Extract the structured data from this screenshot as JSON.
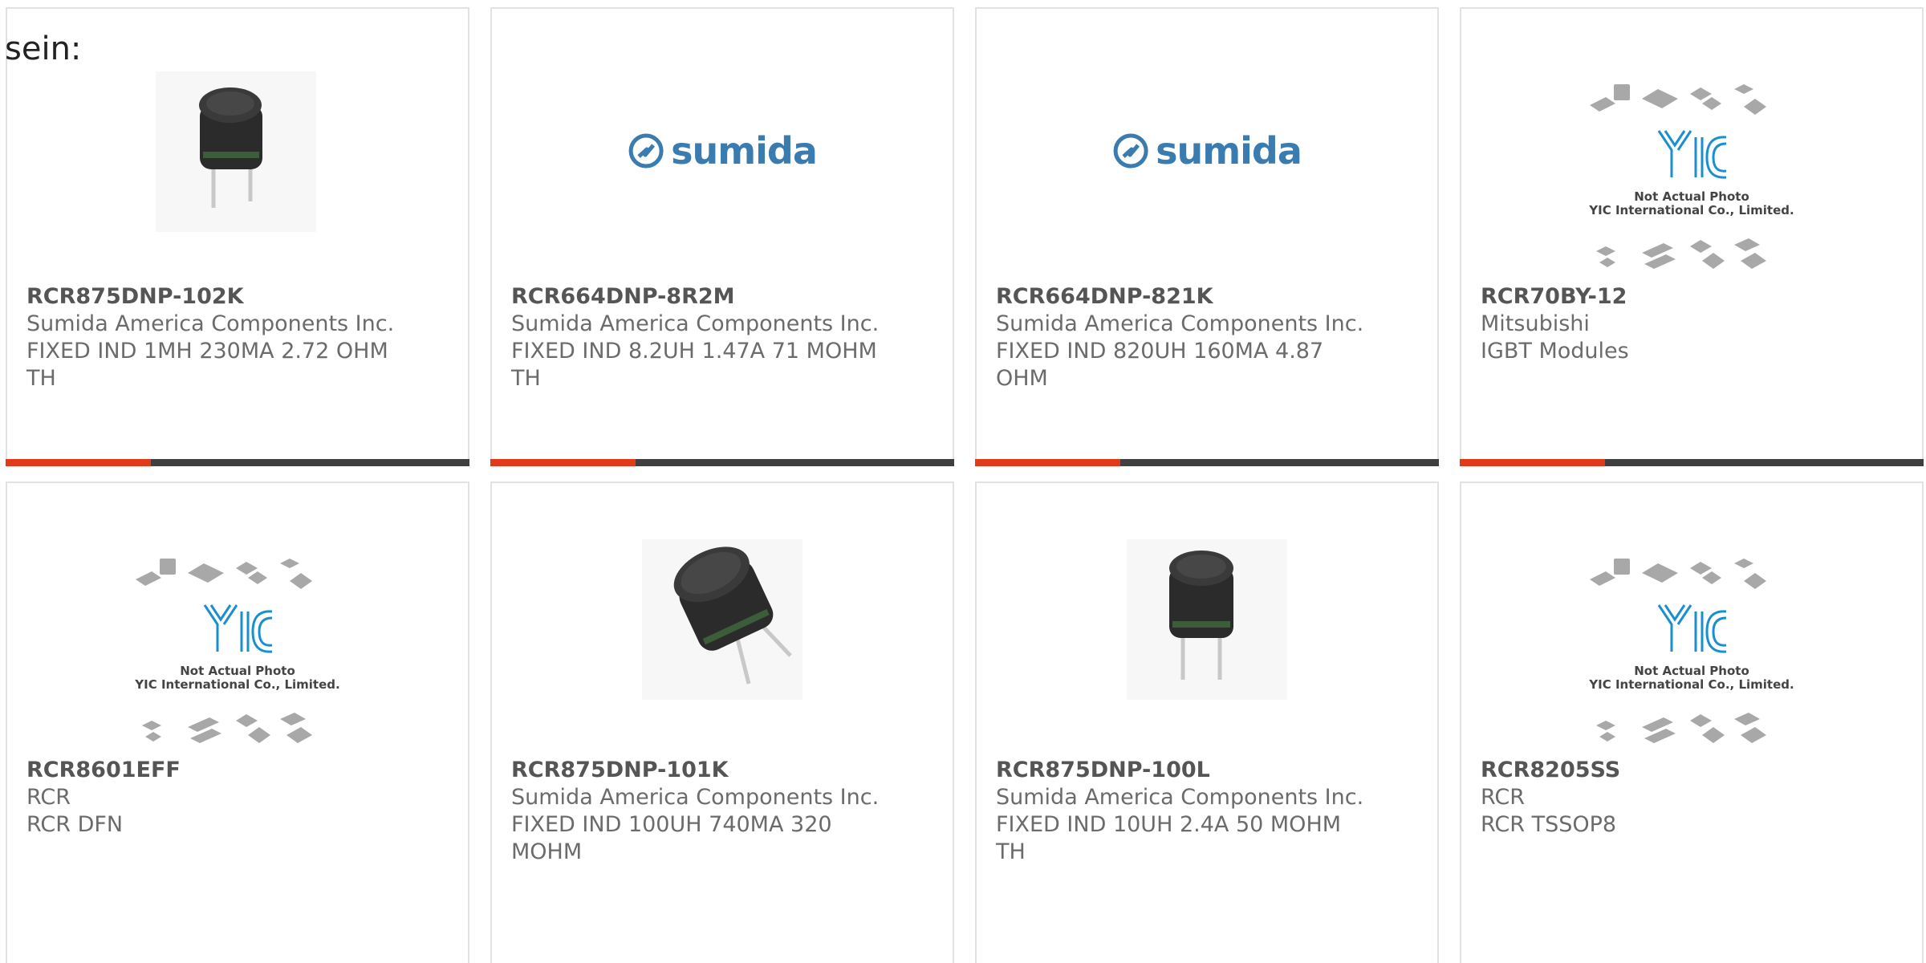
{
  "intro_text": "sein:",
  "colors": {
    "accent": "#e2391a",
    "bar": "#3f3f3f",
    "sumida_blue": "#3a7bb0",
    "yic_blue": "#1a8fd0"
  },
  "placeholder_caption": {
    "line1": "Not Actual Photo",
    "line2": "YIC International Co., Limited."
  },
  "sumida_logo": "sumida",
  "yic_logo": "YIC",
  "products": [
    {
      "part": "RCR875DNP-102K",
      "maker": "Sumida America Components Inc.",
      "desc": "FIXED IND 1MH 230MA 2.72 OHM TH",
      "image": "inductor-photo"
    },
    {
      "part": "RCR664DNP-8R2M",
      "maker": "Sumida America Components Inc.",
      "desc": "FIXED IND 8.2UH 1.47A 71 MOHM TH",
      "image": "sumida-logo"
    },
    {
      "part": "RCR664DNP-821K",
      "maker": "Sumida America Components Inc.",
      "desc": "FIXED IND 820UH 160MA 4.87 OHM",
      "image": "sumida-logo"
    },
    {
      "part": "RCR70BY-12",
      "maker": "Mitsubishi",
      "desc": "IGBT Modules",
      "image": "yic-placeholder"
    },
    {
      "part": "RCR8601EFF",
      "maker": "RCR",
      "desc": "RCR DFN",
      "image": "yic-placeholder"
    },
    {
      "part": "RCR875DNP-101K",
      "maker": "Sumida America Components Inc.",
      "desc": "FIXED IND 100UH 740MA 320 MOHM",
      "image": "inductor-photo-tilted"
    },
    {
      "part": "RCR875DNP-100L",
      "maker": "Sumida America Components Inc.",
      "desc": "FIXED IND 10UH 2.4A 50 MOHM TH",
      "image": "inductor-photo"
    },
    {
      "part": "RCR8205SS",
      "maker": "RCR",
      "desc": "RCR TSSOP8",
      "image": "yic-placeholder"
    }
  ]
}
